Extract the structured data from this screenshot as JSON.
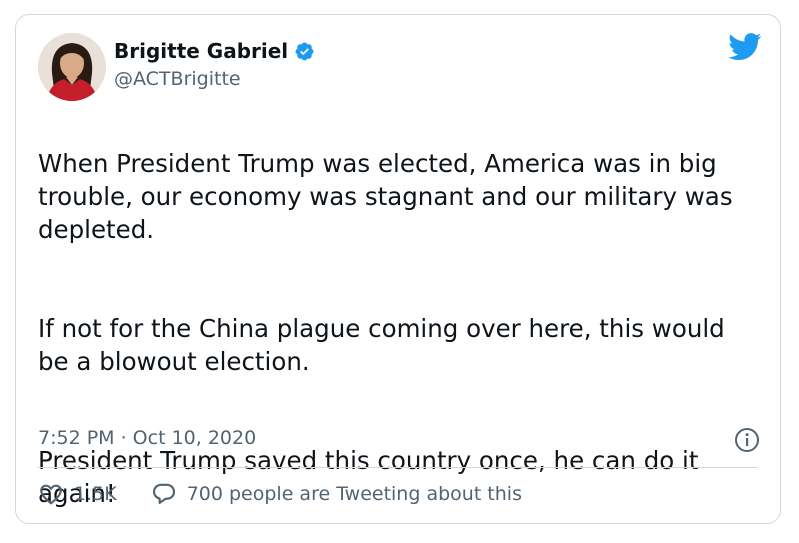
{
  "author": {
    "name": "Brigitte Gabriel",
    "handle": "@ACTBrigitte",
    "verified_icon": "verified-badge-icon",
    "avatar": "profile-photo"
  },
  "brand": {
    "icon": "twitter-bird-icon",
    "color": "#1d9bf0"
  },
  "tweet": {
    "paragraphs": [
      "When President Trump was elected, America was in big trouble, our economy was stagnant and our military was depleted.",
      "If not for the China plague coming over here, this would be a blowout election.",
      "President Trump saved this country once, he can do it again!"
    ],
    "timestamp": "7:52 PM · Oct 10, 2020"
  },
  "actions": {
    "like_count": "1.5K",
    "reply_text": "700 people are Tweeting about this"
  },
  "colors": {
    "text": "#0f1419",
    "secondary": "#536471",
    "border": "#cfd9de",
    "accent": "#1d9bf0"
  }
}
